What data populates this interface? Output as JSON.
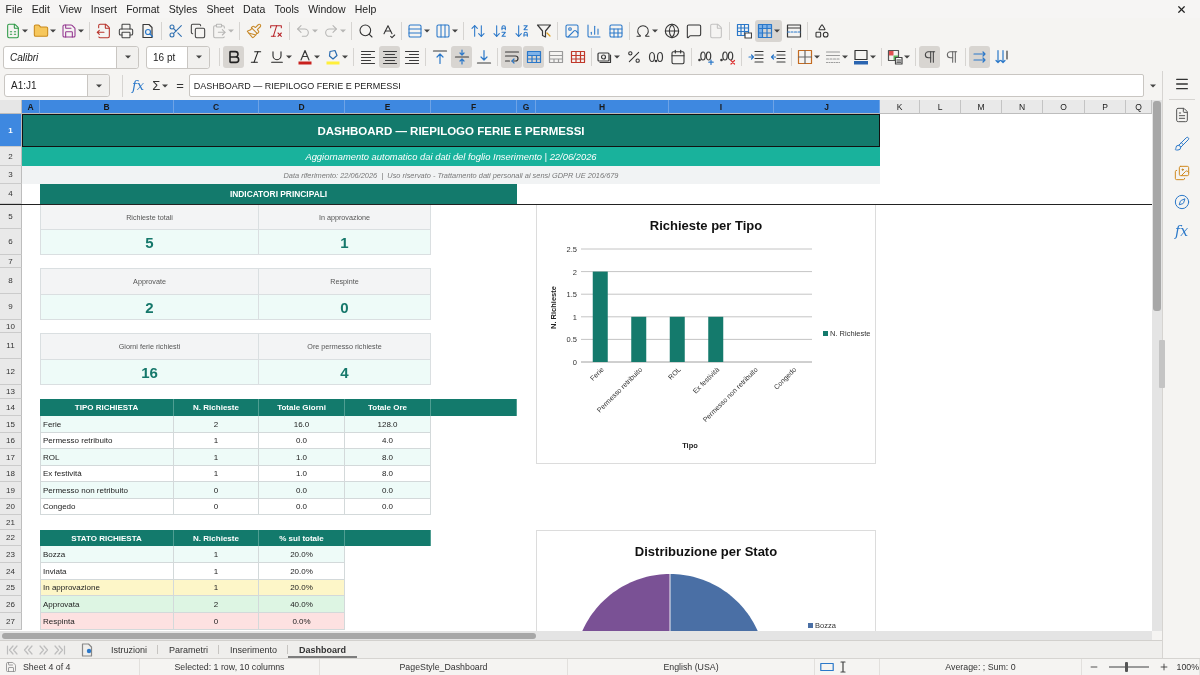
{
  "menu_bar": [
    "File",
    "Edit",
    "View",
    "Insert",
    "Format",
    "Styles",
    "Sheet",
    "Data",
    "Tools",
    "Window",
    "Help"
  ],
  "standard_toolbar": {
    "paste_disabled": true,
    "undo_disabled": true,
    "redo_disabled": true,
    "header_footer_disabled": true,
    "freeze_rows_and_columns_on": true
  },
  "formatting_toolbar": {
    "font_name": "Calibri",
    "font_size": "16 pt",
    "bold_on": true,
    "italic_on": false,
    "underline_on": false,
    "align_left_on": false,
    "align_center_on": true,
    "align_right_on": false,
    "align_top_on": false,
    "center_vertically_on": true,
    "align_bottom_on": false,
    "wrap_text_on": true,
    "merge_and_center_on": true,
    "left_to_right_on": true,
    "right_to_left_on": false,
    "text_horizontal_on": true,
    "text_vertical_on": false
  },
  "formula_bar": {
    "name_box": "A1:J1",
    "function_wizard": "fx",
    "sum": "Σ",
    "formula": "=",
    "content": "DASHBOARD — RIEPILOGO FERIE E PERMESSI"
  },
  "column_headers": [
    {
      "label": "A",
      "selected": true
    },
    {
      "label": "B",
      "selected": true
    },
    {
      "label": "C",
      "selected": true
    },
    {
      "label": "D",
      "selected": true
    },
    {
      "label": "E",
      "selected": true
    },
    {
      "label": "F",
      "selected": true
    },
    {
      "label": "G",
      "selected": true
    },
    {
      "label": "H",
      "selected": true
    },
    {
      "label": "I",
      "selected": true
    },
    {
      "label": "J",
      "selected": true
    },
    {
      "label": "K",
      "selected": false
    },
    {
      "label": "L",
      "selected": false
    },
    {
      "label": "M",
      "selected": false
    },
    {
      "label": "N",
      "selected": false
    },
    {
      "label": "O",
      "selected": false
    },
    {
      "label": "P",
      "selected": false
    },
    {
      "label": "Q",
      "selected": false
    }
  ],
  "row_headers": [
    {
      "label": "1",
      "selected": true
    },
    {
      "label": "2",
      "selected": false
    },
    {
      "label": "3",
      "selected": false
    },
    {
      "label": "4",
      "selected": false
    },
    {
      "label": "5",
      "selected": false
    },
    {
      "label": "6",
      "selected": false
    },
    {
      "label": "7",
      "selected": false
    },
    {
      "label": "8",
      "selected": false
    },
    {
      "label": "9",
      "selected": false
    },
    {
      "label": "10",
      "selected": false
    },
    {
      "label": "11",
      "selected": false
    },
    {
      "label": "12",
      "selected": false
    },
    {
      "label": "13",
      "selected": false
    },
    {
      "label": "14",
      "selected": false
    },
    {
      "label": "15",
      "selected": false
    },
    {
      "label": "16",
      "selected": false
    },
    {
      "label": "17",
      "selected": false
    },
    {
      "label": "18",
      "selected": false
    },
    {
      "label": "19",
      "selected": false
    },
    {
      "label": "20",
      "selected": false
    },
    {
      "label": "21",
      "selected": false
    },
    {
      "label": "22",
      "selected": false
    },
    {
      "label": "23",
      "selected": false
    },
    {
      "label": "24",
      "selected": false
    },
    {
      "label": "25",
      "selected": false
    },
    {
      "label": "26",
      "selected": false
    },
    {
      "label": "27",
      "selected": false
    }
  ],
  "sheet": {
    "title": {
      "text": "DASHBOARD — RIEPILOGO FERIE E PERMESSI",
      "selected": true
    },
    "subtitle": "Aggiornamento automatico dai dati del foglio Inserimento | 22/06/2026",
    "note": "Data riferimento: 22/06/2026  |  Uso riservato - Trattamento dati personali ai sensi GDPR UE 2016/679",
    "kpi_section_title": "INDICATORI PRINCIPALI",
    "kpis": [
      {
        "label": "Richieste totali",
        "value": "5"
      },
      {
        "label": "In approvazione",
        "value": "1"
      },
      {
        "label": "Approvate",
        "value": "2"
      },
      {
        "label": "Respinte",
        "value": "0"
      },
      {
        "label": "Giorni ferie richiesti",
        "value": "16"
      },
      {
        "label": "Ore permesso richieste",
        "value": "4"
      }
    ],
    "type_table": {
      "columns": [
        "TIPO RICHIESTA",
        "N. Richieste",
        "Totale Giorni",
        "Totale Ore"
      ],
      "rows": [
        {
          "cells": [
            "Ferie",
            "2",
            "16.0",
            "128.0"
          ]
        },
        {
          "cells": [
            "Permesso retribuito",
            "1",
            "0.0",
            "4.0"
          ]
        },
        {
          "cells": [
            "ROL",
            "1",
            "1.0",
            "8.0"
          ]
        },
        {
          "cells": [
            "Ex festività",
            "1",
            "1.0",
            "8.0"
          ]
        },
        {
          "cells": [
            "Permesso non retribuito",
            "0",
            "0.0",
            "0.0"
          ]
        },
        {
          "cells": [
            "Congedo",
            "0",
            "0.0",
            "0.0"
          ]
        }
      ]
    },
    "status_table": {
      "columns": [
        "STATO RICHIESTA",
        "N. Richieste",
        "% sul totale"
      ],
      "rows": [
        {
          "cells": [
            "Bozza",
            "1",
            "20.0%"
          ],
          "color": "#eefbf8"
        },
        {
          "cells": [
            "Inviata",
            "1",
            "20.0%"
          ],
          "color": "#ffffff"
        },
        {
          "cells": [
            "In approvazione",
            "1",
            "20.0%"
          ],
          "color": "#fdf6c8"
        },
        {
          "cells": [
            "Approvata",
            "2",
            "40.0%"
          ],
          "color": "#ddf5e3"
        },
        {
          "cells": [
            "Respinta",
            "0",
            "0.0%"
          ],
          "color": "#fde1e1"
        }
      ]
    }
  },
  "charts": [
    {
      "chart_data": {
        "type": "bar",
        "title": "Richieste per Tipo",
        "xlabel": "Tipo",
        "ylabel": "N. Richieste",
        "categories": [
          "Ferie",
          "Permesso retribuito",
          "ROL",
          "Ex festività",
          "Permesso non retribuito",
          "Congedo"
        ],
        "series": [
          {
            "name": "N. Richieste",
            "color": "#147a6c",
            "values": [
              2,
              1,
              1,
              1,
              0,
              0
            ]
          }
        ],
        "ylim": [
          0,
          2.5
        ],
        "yticks": [
          0,
          0.5,
          1,
          1.5,
          2,
          2.5
        ],
        "grid": true
      }
    },
    {
      "kind": "pie",
      "title": "Distribuzione per Stato",
      "legend": [
        {
          "label": "Bozza",
          "color": "#4a6fa5"
        }
      ]
    }
  ],
  "sheet_tabs": [
    {
      "label": "Istruzioni",
      "selected": false
    },
    {
      "label": "Parametri",
      "selected": false
    },
    {
      "label": "Inserimento",
      "selected": false
    },
    {
      "label": "Dashboard",
      "selected": true
    }
  ],
  "sidebar": {
    "functions": "fx"
  },
  "status_bar": {
    "sheet_position": "Sheet 4 of 4",
    "selection": "Selected: 1 row, 10 columns",
    "page_style": "PageStyle_Dashboard",
    "language": "English (USA)",
    "summary": "Average: ; Sum: 0",
    "zoom_slider": {
      "level": 0.45
    },
    "zoom": "100%"
  }
}
